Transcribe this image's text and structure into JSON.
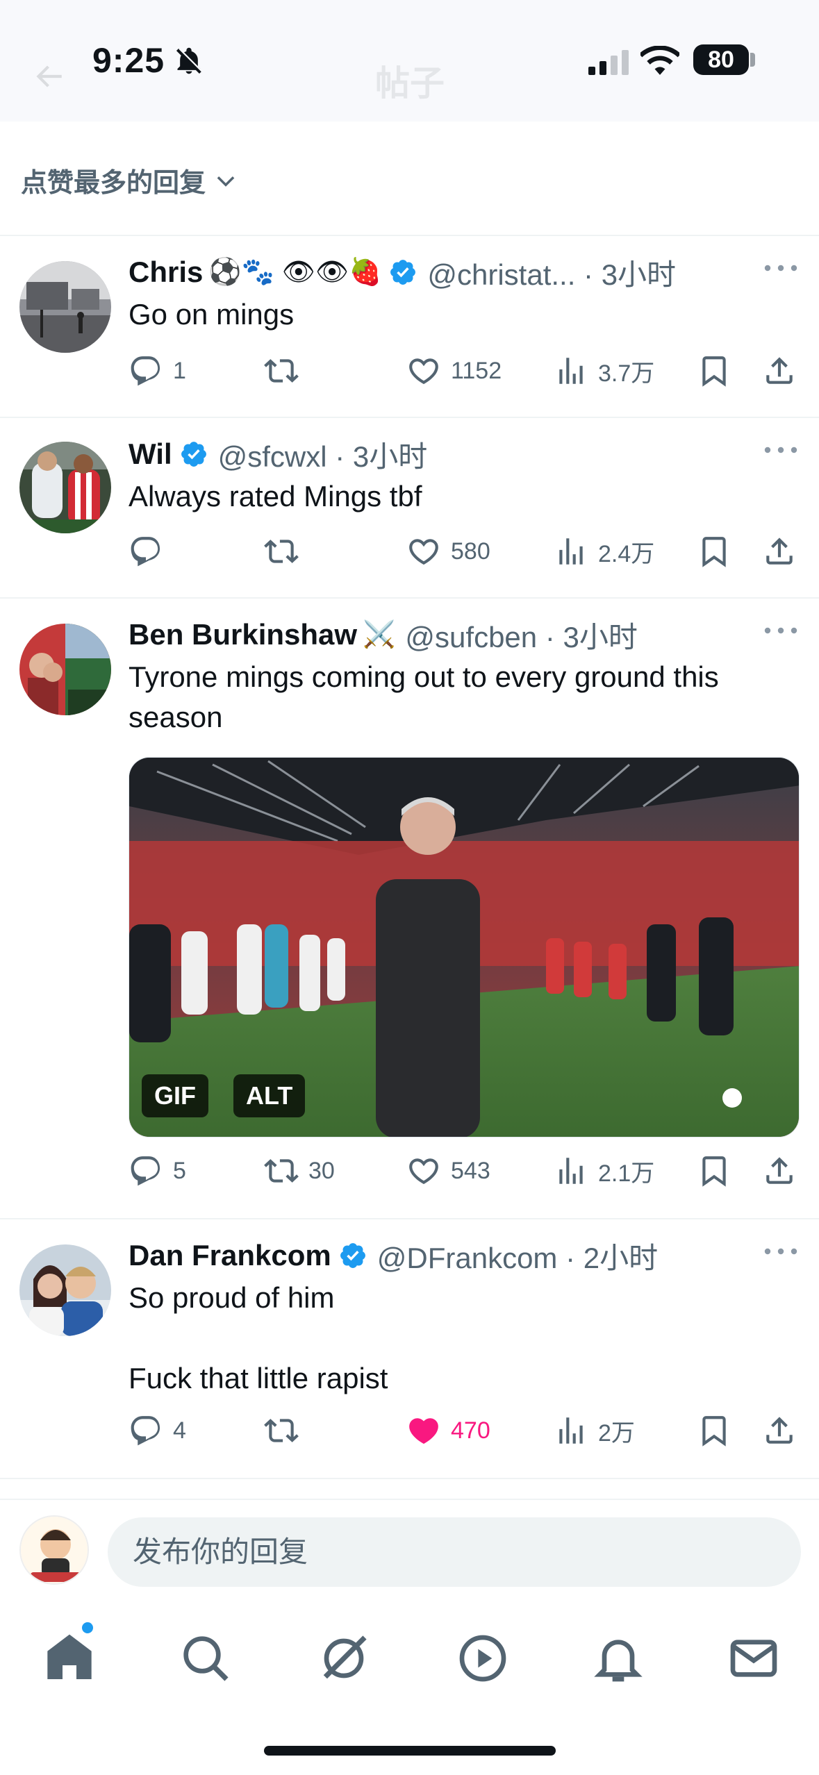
{
  "status_bar": {
    "time": "9:25",
    "battery": "80"
  },
  "ghost_header": {
    "title": "帖子"
  },
  "sort": {
    "label": "点赞最多的回复"
  },
  "posts": [
    {
      "name": "Chris",
      "emoji": "⚽🐾 👁👁🍓",
      "verified": true,
      "handle": "@christat... · 3小时",
      "text": "Go on mings",
      "replies": "1",
      "retweets": "",
      "likes": "1152",
      "views": "3.7万",
      "liked": false
    },
    {
      "name": "Wil",
      "emoji": "",
      "verified": true,
      "handle": "@sfcwxl · 3小时",
      "text": "Always rated Mings tbf",
      "replies": "",
      "retweets": "",
      "likes": "580",
      "views": "2.4万",
      "liked": false
    },
    {
      "name": "Ben Burkinshaw",
      "emoji": "⚔️",
      "verified": false,
      "handle": "@sufcben · 3小时",
      "text": "Tyrone mings coming out to every ground this season",
      "media": {
        "badge_gif": "GIF",
        "badge_alt": "ALT"
      },
      "replies": "5",
      "retweets": "30",
      "likes": "543",
      "views": "2.1万",
      "liked": false
    },
    {
      "name": "Dan Frankcom",
      "emoji": "",
      "verified": true,
      "handle": "@DFrankcom · 2小时",
      "text": "So proud of him\n\nFuck that little rapist",
      "replies": "4",
      "retweets": "",
      "likes": "470",
      "views": "2万",
      "liked": true
    }
  ],
  "reply_bar": {
    "placeholder": "发布你的回复"
  },
  "tabs": [
    "home-icon",
    "search-icon",
    "grok-icon",
    "video-icon",
    "notifications-icon",
    "messages-icon"
  ],
  "colors": {
    "accent": "#1d9bf0",
    "like": "#f91880",
    "muted": "#536471"
  }
}
